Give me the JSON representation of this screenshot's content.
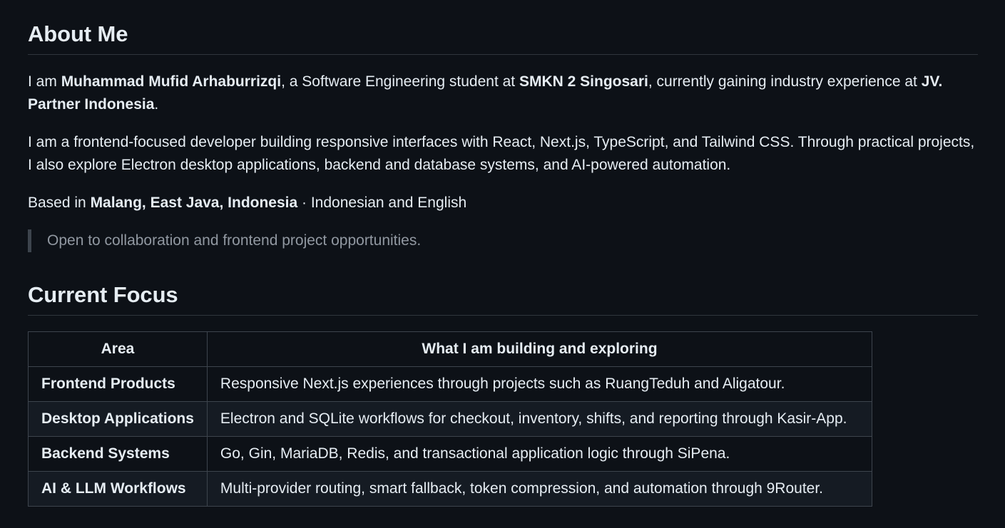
{
  "about": {
    "heading": "About Me",
    "intro_p1": "I am ",
    "name": "Muhammad Mufid Arhaburrizqi",
    "intro_p2": ", a Software Engineering student at ",
    "school": "SMKN 2 Singosari",
    "intro_p3": ", currently gaining industry experience at ",
    "company": "JV. Partner Indonesia",
    "intro_p4": ".",
    "paragraph2": "I am a frontend-focused developer building responsive interfaces with React, Next.js, TypeScript, and Tailwind CSS. Through practical projects, I also explore Electron desktop applications, backend and database systems, and AI-powered automation.",
    "location_prefix": "Based in ",
    "location": "Malang, East Java, Indonesia",
    "languages": " · Indonesian and English",
    "quote": "Open to collaboration and frontend project opportunities."
  },
  "focus": {
    "heading": "Current Focus",
    "columns": [
      "Area",
      "What I am building and exploring"
    ],
    "rows": [
      {
        "area": "Frontend Products",
        "desc": "Responsive Next.js experiences through projects such as RuangTeduh and Aligatour."
      },
      {
        "area": "Desktop Applications",
        "desc": "Electron and SQLite workflows for checkout, inventory, shifts, and reporting through Kasir-App."
      },
      {
        "area": "Backend Systems",
        "desc": "Go, Gin, MariaDB, Redis, and transactional application logic through SiPena."
      },
      {
        "area": "AI & LLM Workflows",
        "desc": "Multi-provider routing, smart fallback, token compression, and automation through 9Router."
      }
    ]
  }
}
